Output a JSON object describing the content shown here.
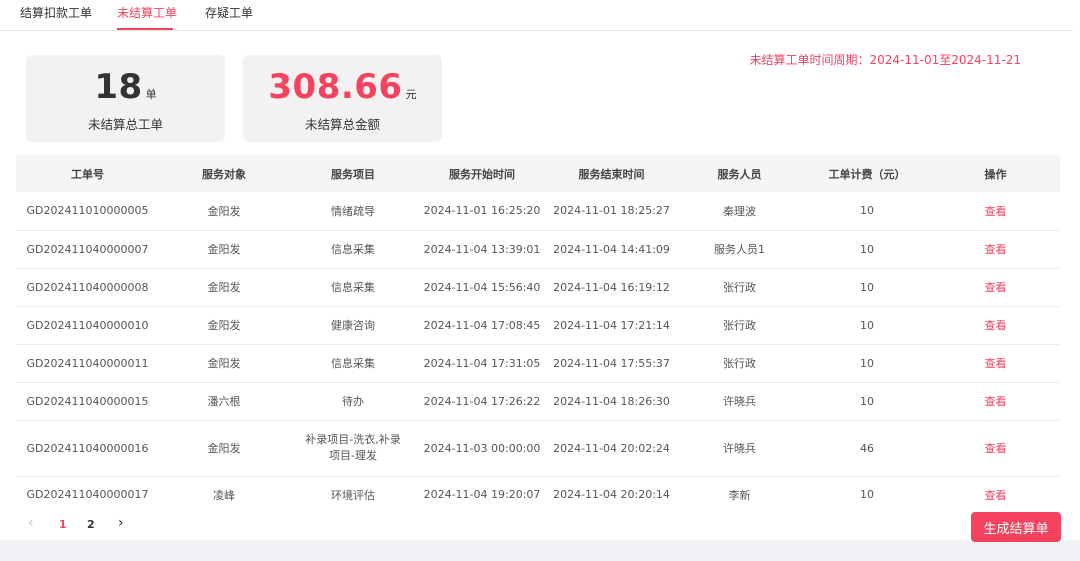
{
  "tabs": [
    {
      "label": "结算扣款工单"
    },
    {
      "label": "未结算工单"
    },
    {
      "label": "存疑工单"
    }
  ],
  "active_tab": 1,
  "period_text": "未结算工单时间周期：2024-11-01至2024-11-21",
  "summary": {
    "count": {
      "value": "18",
      "unit": "单",
      "label": "未结算总工单"
    },
    "amount": {
      "value": "308.66",
      "unit": "元",
      "label": "未结算总金额"
    }
  },
  "table": {
    "headers": [
      "工单号",
      "服务对象",
      "服务项目",
      "服务开始时间",
      "服务结束时间",
      "服务人员",
      "工单计费（元）",
      "操作"
    ],
    "rows": [
      [
        "GD202411010000005",
        "金阳发",
        "情绪疏导",
        "2024-11-01 16:25:20",
        "2024-11-01 18:25:27",
        "秦理波",
        "10",
        "查看"
      ],
      [
        "GD202411040000007",
        "金阳发",
        "信息采集",
        "2024-11-04 13:39:01",
        "2024-11-04 14:41:09",
        "服务人员1",
        "10",
        "查看"
      ],
      [
        "GD202411040000008",
        "金阳发",
        "信息采集",
        "2024-11-04 15:56:40",
        "2024-11-04 16:19:12",
        "张行政",
        "10",
        "查看"
      ],
      [
        "GD202411040000010",
        "金阳发",
        "健康咨询",
        "2024-11-04 17:08:45",
        "2024-11-04 17:21:14",
        "张行政",
        "10",
        "查看"
      ],
      [
        "GD202411040000011",
        "金阳发",
        "信息采集",
        "2024-11-04 17:31:05",
        "2024-11-04 17:55:37",
        "张行政",
        "10",
        "查看"
      ],
      [
        "GD202411040000015",
        "潘六根",
        "待办",
        "2024-11-04 17:26:22",
        "2024-11-04 18:26:30",
        "许晓兵",
        "10",
        "查看"
      ],
      [
        "GD202411040000016",
        "金阳发",
        "补录项目-洗衣,补录项目-理发",
        "2024-11-03 00:00:00",
        "2024-11-04 20:02:24",
        "许晓兵",
        "46",
        "查看"
      ],
      [
        "GD202411040000017",
        "凌峰",
        "环境评估",
        "2024-11-04 19:20:07",
        "2024-11-04 20:20:14",
        "李新",
        "10",
        "查看"
      ]
    ]
  },
  "pagination": {
    "prev": "‹",
    "pages": [
      "1",
      "2"
    ],
    "current": "1",
    "next": "›"
  },
  "generate_button": "生成结算单",
  "colors": {
    "accent": "#f5425f",
    "card_bg": "#f2f2f2",
    "header_bg": "#f5f5f7"
  }
}
